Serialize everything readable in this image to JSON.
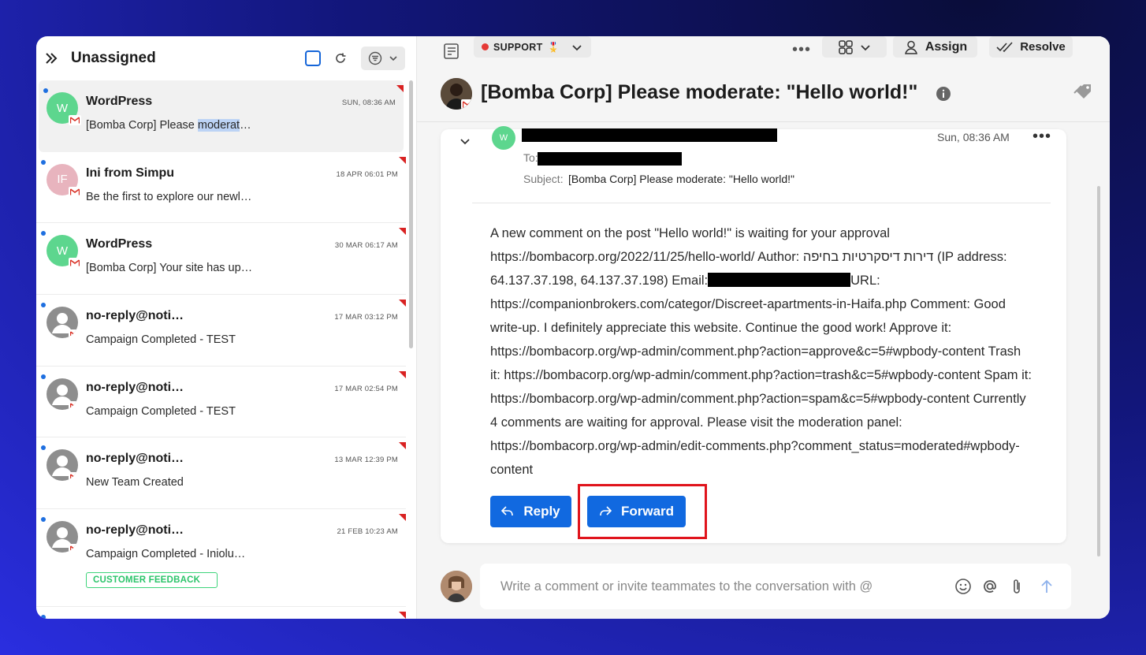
{
  "left_panel": {
    "title": "Unassigned",
    "icons": [
      "double-chevron-right-icon",
      "checkbox-icon",
      "refresh-icon",
      "filter-icon",
      "chevron-down-icon"
    ]
  },
  "conversations": [
    {
      "initials": "W",
      "avatar_color": "#5dd68e",
      "name": "WordPress",
      "time": "SUN, 08:36 AM",
      "preview_before": "[Bomba Corp] Please ",
      "preview_highlight": "moderat",
      "preview_after": "…"
    },
    {
      "initials": "IF",
      "avatar_color": "#e8b4be",
      "name": "Ini from Simpu",
      "time": "18 APR 06:01 PM",
      "preview": "Be the first to explore our newl…"
    },
    {
      "initials": "W",
      "avatar_color": "#5dd68e",
      "name": "WordPress",
      "time": "30 MAR 06:17 AM",
      "preview": "[Bomba Corp] Your site has up…"
    },
    {
      "name": "no-reply@noti…",
      "time": "17 MAR 03:12 PM",
      "preview": "Campaign Completed - TEST"
    },
    {
      "name": "no-reply@noti…",
      "time": "17 MAR 02:54 PM",
      "preview": "Campaign Completed - TEST"
    },
    {
      "name": "no-reply@noti…",
      "time": "13 MAR 12:39 PM",
      "preview": "New Team Created"
    },
    {
      "name": "no-reply@noti…",
      "time": "21 FEB 10:23 AM",
      "preview": "Campaign Completed - Iniolu…",
      "tag": "CUSTOMER FEEDBACK"
    }
  ],
  "toolbar": {
    "inbox_label": "SUPPORT",
    "inbox_emoji": "🎖️",
    "assign_label": "Assign",
    "resolve_label": "Resolve"
  },
  "conversation": {
    "title": "[Bomba Corp] Please moderate: \"Hello world!\"",
    "message": {
      "sender_initial": "W",
      "time": "Sun, 08:36 AM",
      "to_label": "To:",
      "subject_label": "Subject:",
      "subject": "[Bomba Corp] Please moderate: \"Hello world!\"",
      "body_part1": "A new comment on the post \"Hello world!\" is waiting for your approval https://bombacorp.org/2022/11/25/hello-world/ Author: דירות דיסקרטיות בחיפה (IP address: 64.137.37.198, 64.137.37.198) Email:",
      "body_part2": "URL: https://companionbrokers.com/categor/Discreet-apartments-in-Haifa.php Comment: Good write-up. I definitely appreciate this website. Continue the good work! Approve it: https://bombacorp.org/wp-admin/comment.php?action=approve&c=5#wpbody-content Trash it: https://bombacorp.org/wp-admin/comment.php?action=trash&c=5#wpbody-content Spam it: https://bombacorp.org/wp-admin/comment.php?action=spam&c=5#wpbody-content Currently 4 comments are waiting for approval. Please visit the moderation panel: https://bombacorp.org/wp-admin/edit-comments.php?comment_status=moderated#wpbody-content",
      "reply_label": "Reply",
      "forward_label": "Forward"
    }
  },
  "composer": {
    "placeholder": "Write a comment or invite teammates to the conversation with @"
  },
  "colors": {
    "primary": "#1169e0",
    "highlight_box": "#e0141c",
    "unread_dot": "#1e6fe0",
    "tag_green": "#2bc46a"
  }
}
